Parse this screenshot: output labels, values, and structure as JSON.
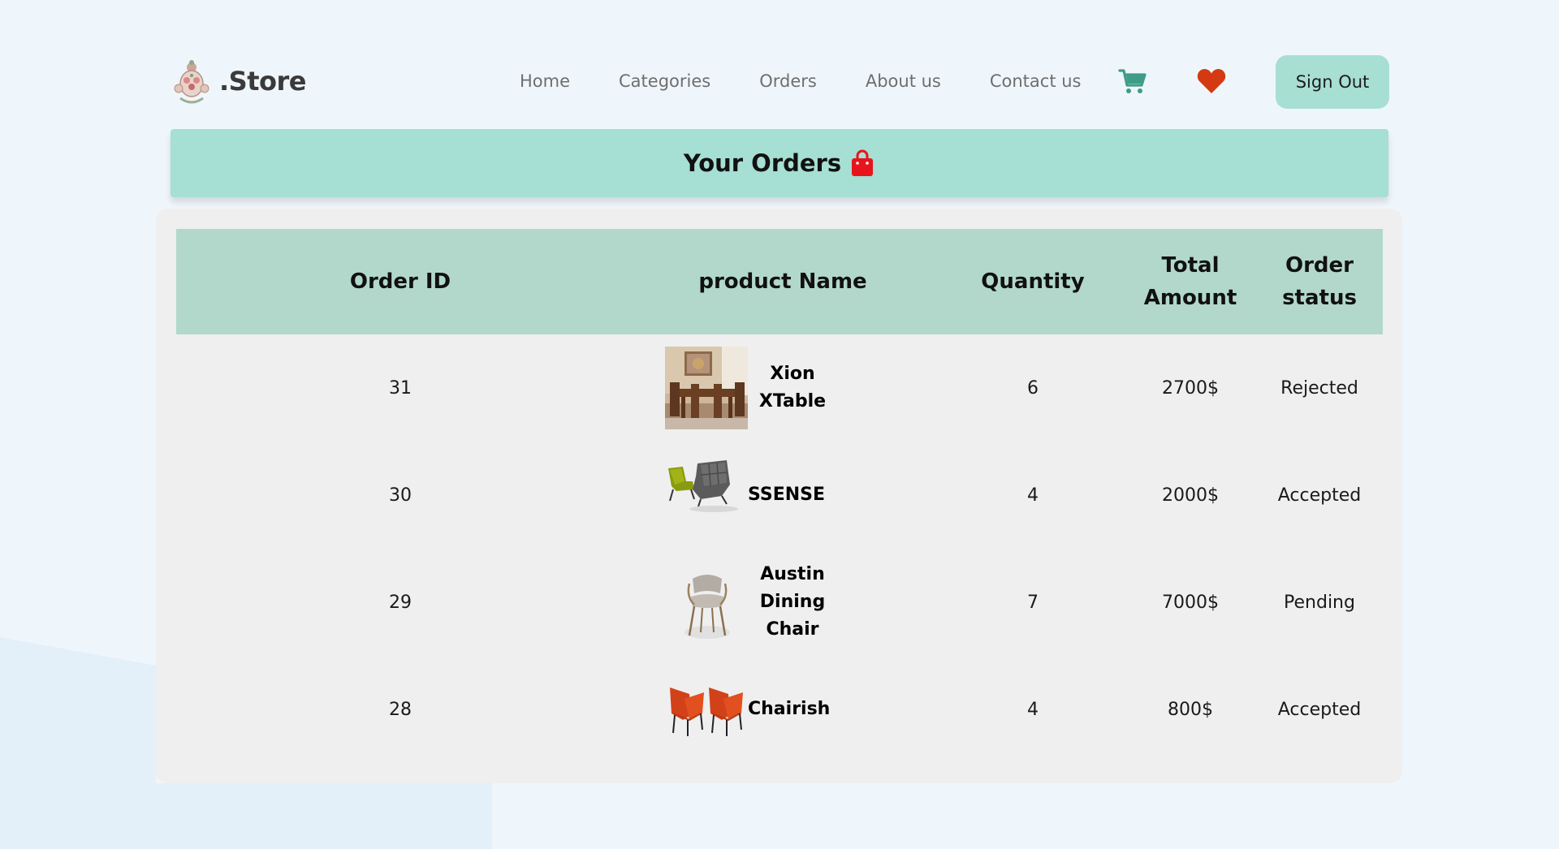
{
  "brand": {
    "name": ".Store"
  },
  "nav": {
    "links": [
      "Home",
      "Categories",
      "Orders",
      "About us",
      "Contact us"
    ],
    "signout_label": "Sign Out"
  },
  "banner": {
    "title": "Your Orders"
  },
  "table": {
    "headers": {
      "order_id": "Order ID",
      "product_name": "product Name",
      "quantity": "Quantity",
      "total_line1": "Total",
      "total_line2": "Amount",
      "status_line1": "Order",
      "status_line2": "status"
    },
    "rows": [
      {
        "order_id": "31",
        "product": "Xion XTable",
        "quantity": "6",
        "total": "2700$",
        "status": "Rejected"
      },
      {
        "order_id": "30",
        "product": "SSENSE",
        "quantity": "4",
        "total": "2000$",
        "status": "Accepted"
      },
      {
        "order_id": "29",
        "product": "Austin Dining Chair",
        "quantity": "7",
        "total": "7000$",
        "status": "Pending"
      },
      {
        "order_id": "28",
        "product": "Chairish",
        "quantity": "4",
        "total": "800$",
        "status": "Accepted"
      }
    ]
  },
  "colors": {
    "accent": "#a6dfd3",
    "header_bg": "#b2d8cb",
    "rejected": "#e01b24",
    "accepted": "#1f8a1f",
    "pending": "#1d1ddb",
    "heart": "#d43a12",
    "cart": "#3e9c88"
  },
  "icons": {
    "cart": "shopping-cart-icon",
    "heart": "heart-icon",
    "bag": "shopping-bag-icon",
    "logo": "floral-logo-icon"
  }
}
